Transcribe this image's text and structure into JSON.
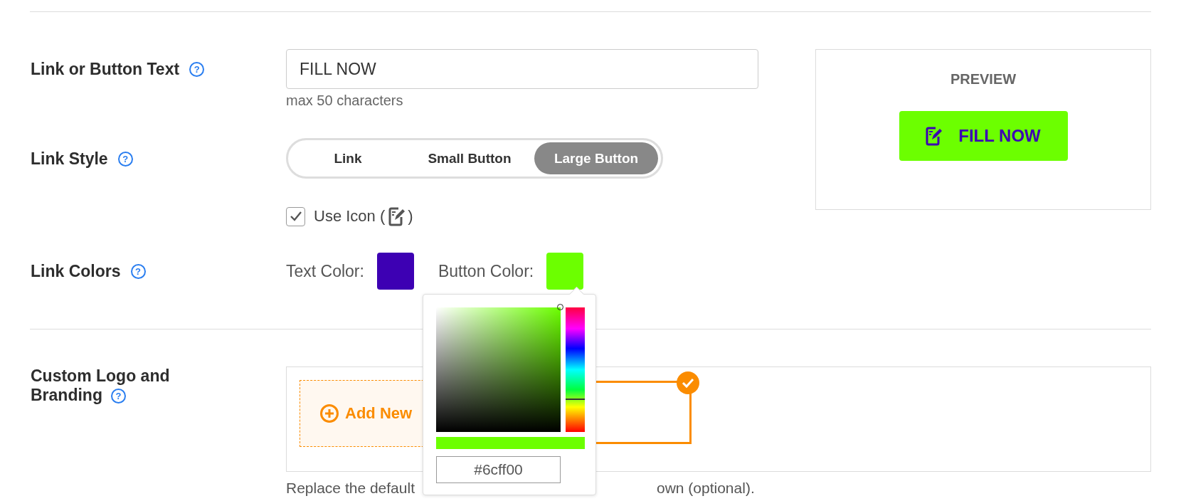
{
  "link_text": {
    "label": "Link or Button Text",
    "help": "?",
    "value": "FILL NOW",
    "hint": "max 50 characters"
  },
  "link_style": {
    "label": "Link Style",
    "help": "?",
    "options": [
      {
        "label": "Link",
        "selected": false
      },
      {
        "label": "Small Button",
        "selected": false
      },
      {
        "label": "Large Button",
        "selected": true
      }
    ]
  },
  "use_icon": {
    "label_before": "Use Icon (",
    "label_after": ")",
    "checked": true
  },
  "link_colors": {
    "label": "Link Colors",
    "help": "?",
    "swatches": [
      {
        "label": "Text Color:",
        "color": "#3d00b3"
      },
      {
        "label": "Button Color:",
        "color": "#6cff00"
      }
    ]
  },
  "color_picker": {
    "hue": {
      "level": 0.26
    },
    "hex": "#6cff00"
  },
  "preview": {
    "title": "PREVIEW",
    "button_text": "FILL NOW"
  },
  "custom_logo": {
    "label": "Custom Logo and Branding",
    "help": "?",
    "add_new": "Add New",
    "note_start": "Replace the default",
    "note_end": "own (optional)."
  }
}
